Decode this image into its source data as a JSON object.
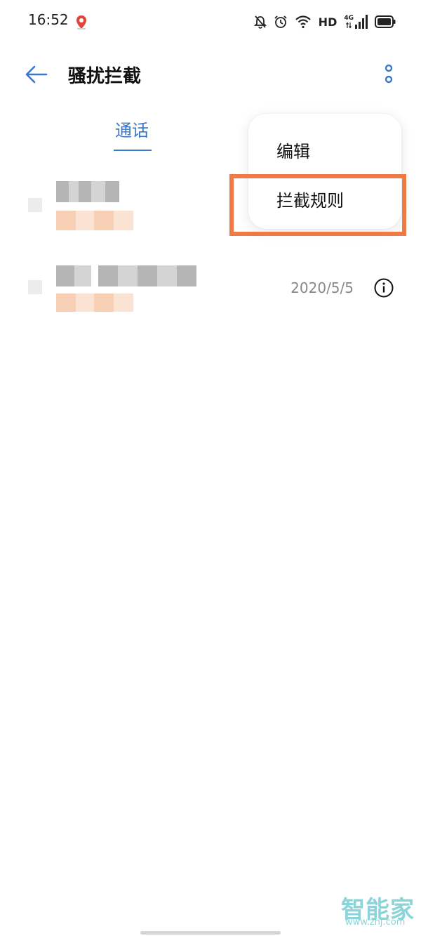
{
  "status_bar": {
    "time": "16:52",
    "hd": "HD",
    "network": "4G"
  },
  "header": {
    "title": "骚扰拦截"
  },
  "tabs": [
    {
      "label": "通话",
      "active": true
    }
  ],
  "call_list": [
    {
      "date": ""
    },
    {
      "date": "2020/5/5"
    }
  ],
  "popup_menu": {
    "items": [
      {
        "label": "编辑"
      },
      {
        "label": "拦截规则",
        "highlighted": true
      }
    ]
  },
  "watermark": {
    "logo": "智能家",
    "url": "www.znj.com"
  },
  "colors": {
    "accent": "#3a78c9",
    "highlight": "#f07a45",
    "watermark": "#7fd1d6"
  }
}
